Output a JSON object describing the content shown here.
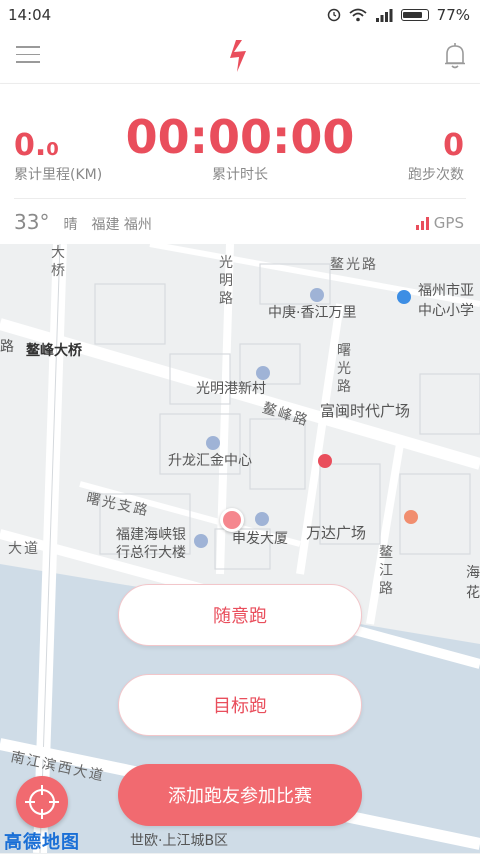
{
  "status_bar": {
    "time": "14:04",
    "battery": "77%"
  },
  "stats": {
    "distance_main": "0.",
    "distance_dec": "0",
    "distance_label": "累计里程(KM)",
    "time_value": "00:00:00",
    "time_label": "累计时长",
    "count_value": "0",
    "count_label": "跑步次数"
  },
  "weather": {
    "temp": "33°",
    "condition": "晴",
    "location": "福建 福州",
    "gps_label": "GPS"
  },
  "map": {
    "labels": {
      "aoguang_road": "鳌光路",
      "fuzhou_school": "福州市亚",
      "fuzhou_school2": "中心小学",
      "zhonggeng": "中庚·香江万里",
      "aofeng_bridge": "鳌峰大桥",
      "guangminggang": "光明港新村",
      "aofeng_road": "鳌峰路",
      "fumin": "富闽时代广场",
      "shenglong": "升龙汇金中心",
      "shuguang_branch": "曙光支路",
      "fujian_bank1": "福建海峡银",
      "fujian_bank2": "行总行大楼",
      "shenfa": "申发大厦",
      "wanda": "万达广场",
      "dadao": "大道",
      "nanjiang": "南江滨西大道",
      "shiou": "世欧·上江城B区",
      "guangming_road": "光明路",
      "shuguang_road": "曙光路",
      "aojiang_road": "鳌江路",
      "qiao": "大桥",
      "road_left": "路",
      "right_edge1": "海",
      "right_edge2": "花"
    },
    "provider": "高德地图"
  },
  "buttons": {
    "free_run": "随意跑",
    "goal_run": "目标跑",
    "race": "添加跑友参加比赛"
  },
  "colors": {
    "accent": "#e94e5c",
    "button_fill": "#f16a70"
  }
}
